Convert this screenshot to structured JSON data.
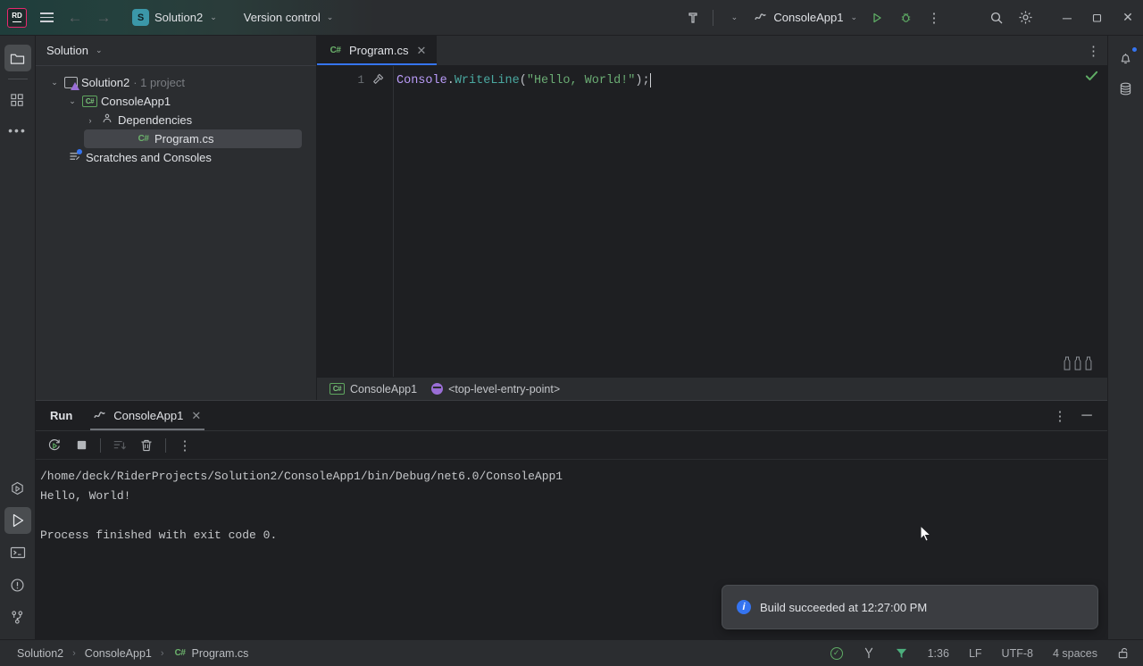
{
  "titlebar": {
    "logo": "RD",
    "menu_icon": "hamburger-menu-icon",
    "back_icon": "←",
    "forward_icon": "→",
    "solution_badge": "S",
    "solution_name": "Solution2",
    "vcs_label": "Version control",
    "caret": "⌄",
    "build_icon": "hammer-icon",
    "run_config_icon": "run-config-icon",
    "run_config_name": "ConsoleApp1",
    "run_icon": "▷",
    "debug_icon": "bug-icon",
    "more_icon": "⋮",
    "search_icon": "search-icon",
    "settings_icon": "gear-icon",
    "minimize": "─",
    "maximize": "❐",
    "close": "✕"
  },
  "left_rail": {
    "top_items": [
      {
        "name": "project-tool-window",
        "icon": "folder-icon",
        "active": true
      },
      {
        "name": "structure-tool-window",
        "icon": "squares-icon",
        "active": false
      },
      {
        "name": "more-tool-windows",
        "icon": "ellipsis-icon",
        "active": false
      }
    ],
    "bottom_items": [
      {
        "name": "services-tool-window",
        "icon": "hexagon-play-icon",
        "active": false
      },
      {
        "name": "run-tool-window",
        "icon": "play-icon",
        "active": true
      },
      {
        "name": "terminal-tool-window",
        "icon": "terminal-icon",
        "active": false
      },
      {
        "name": "problems-tool-window",
        "icon": "warning-circle-icon",
        "active": false
      },
      {
        "name": "git-tool-window",
        "icon": "git-branch-icon",
        "active": false
      }
    ]
  },
  "right_rail": {
    "items": [
      {
        "name": "notifications",
        "icon": "bell-icon",
        "has_badge": true
      },
      {
        "name": "database-tool-window",
        "icon": "database-icon",
        "has_badge": false
      }
    ]
  },
  "solution_panel": {
    "title": "Solution",
    "caret": "⌄",
    "tree": [
      {
        "indent": 0,
        "twisty": "⌄",
        "icon": "solution-icon",
        "label": "Solution2",
        "sub": "· 1 project",
        "selected": false
      },
      {
        "indent": 1,
        "twisty": "⌄",
        "icon": "csharp-project-icon",
        "label": "ConsoleApp1",
        "sub": "",
        "selected": false
      },
      {
        "indent": 2,
        "twisty": "›",
        "icon": "dependencies-icon",
        "label": "Dependencies",
        "sub": "",
        "selected": false
      },
      {
        "indent": 3,
        "twisty": "",
        "icon": "csharp-file-icon",
        "label": "Program.cs",
        "sub": "",
        "selected": true
      },
      {
        "indent": 1,
        "twisty": "",
        "icon": "scratches-icon",
        "label": "Scratches and Consoles",
        "sub": "",
        "selected": false
      }
    ]
  },
  "editor": {
    "tab": {
      "icon": "csharp-file-icon",
      "label": "Program.cs",
      "close": "✕"
    },
    "tabbar_more": "⋮",
    "gutter_icon": "hammer-icon",
    "line_number": "1",
    "code_tokens": [
      {
        "text": "Console",
        "kind": "type"
      },
      {
        "text": ".",
        "kind": "punct"
      },
      {
        "text": "WriteLine",
        "kind": "method"
      },
      {
        "text": "(",
        "kind": "punct"
      },
      {
        "text": "\"Hello, World!\"",
        "kind": "string"
      },
      {
        "text": ")",
        "kind": "punct"
      },
      {
        "text": ";",
        "kind": "punct"
      }
    ],
    "inspection_status_icon": "green-check-icon",
    "code_vision_icon": "vials-icon",
    "breadcrumbs": [
      {
        "icon": "csharp-project-icon",
        "label": "ConsoleApp1"
      },
      {
        "icon": "method-icon",
        "label": "<top-level-entry-point>"
      }
    ]
  },
  "run_window": {
    "tabs": [
      {
        "label": "Run",
        "icon": "",
        "active": false,
        "bold": true
      },
      {
        "label": "ConsoleApp1",
        "icon": "run-config-icon",
        "active": true,
        "bold": false,
        "close": "✕"
      }
    ],
    "header_more_icon": "⋮",
    "header_minimize_icon": "─",
    "toolbar": [
      {
        "name": "rerun-button",
        "icon": "rerun-icon",
        "disabled": false
      },
      {
        "name": "stop-button",
        "icon": "stop-icon",
        "disabled": false
      },
      {
        "name": "scroll-to-end-button",
        "icon": "scroll-end-icon",
        "disabled": true
      },
      {
        "name": "clear-all-button",
        "icon": "trash-icon",
        "disabled": false
      },
      {
        "name": "more-options-button",
        "icon": "⋮",
        "disabled": false
      }
    ],
    "console_lines": [
      "/home/deck/RiderProjects/Solution2/ConsoleApp1/bin/Debug/net6.0/ConsoleApp1",
      "Hello, World!",
      "",
      "Process finished with exit code 0."
    ]
  },
  "toast": {
    "icon": "info-icon",
    "icon_glyph": "i",
    "message": "Build succeeded at 12:27:00 PM",
    "accent": "#3574f0"
  },
  "statusbar": {
    "breadcrumbs": [
      {
        "label": "Solution2",
        "icon": ""
      },
      {
        "label": "ConsoleApp1",
        "icon": ""
      },
      {
        "label": "Program.cs",
        "icon": "csharp-file-icon"
      }
    ],
    "separator": "›",
    "right_items": [
      {
        "name": "inspection-status",
        "icon": "green-check-circle-icon",
        "label": ""
      },
      {
        "name": "branch-indicator",
        "icon": "branch-glyph-icon",
        "label": ""
      },
      {
        "name": "filter-indicator",
        "icon": "green-triangle-icon",
        "label": ""
      },
      {
        "name": "caret-position",
        "icon": "",
        "label": "1:36"
      },
      {
        "name": "line-separator",
        "icon": "",
        "label": "LF"
      },
      {
        "name": "file-encoding",
        "icon": "",
        "label": "UTF-8"
      },
      {
        "name": "indent-size",
        "icon": "",
        "label": "4 spaces"
      },
      {
        "name": "readonly-toggle",
        "icon": "lock-open-icon",
        "label": ""
      }
    ]
  },
  "colors": {
    "accent_blue": "#3574f0",
    "accent_green": "#5fad65",
    "titlebar_teal": "#1f3d3b",
    "panel_bg": "#2b2d30",
    "editor_bg": "#1e1f22",
    "selection": "#43454a"
  }
}
